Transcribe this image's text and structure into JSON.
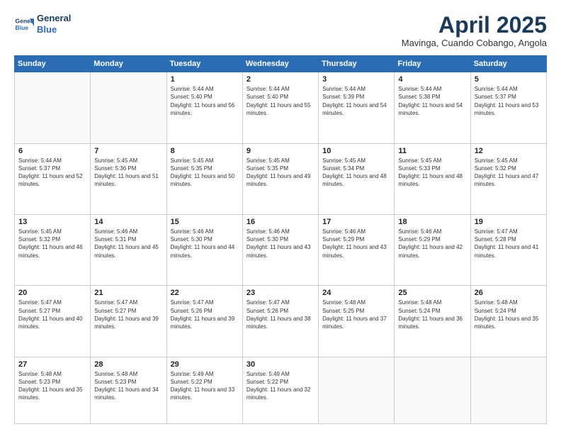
{
  "header": {
    "logo_line1": "General",
    "logo_line2": "Blue",
    "month": "April 2025",
    "location": "Mavinga, Cuando Cobango, Angola"
  },
  "weekdays": [
    "Sunday",
    "Monday",
    "Tuesday",
    "Wednesday",
    "Thursday",
    "Friday",
    "Saturday"
  ],
  "weeks": [
    [
      {
        "day": "",
        "info": ""
      },
      {
        "day": "",
        "info": ""
      },
      {
        "day": "1",
        "info": "Sunrise: 5:44 AM\nSunset: 5:40 PM\nDaylight: 11 hours and 56 minutes."
      },
      {
        "day": "2",
        "info": "Sunrise: 5:44 AM\nSunset: 5:40 PM\nDaylight: 11 hours and 55 minutes."
      },
      {
        "day": "3",
        "info": "Sunrise: 5:44 AM\nSunset: 5:39 PM\nDaylight: 11 hours and 54 minutes."
      },
      {
        "day": "4",
        "info": "Sunrise: 5:44 AM\nSunset: 5:38 PM\nDaylight: 11 hours and 54 minutes."
      },
      {
        "day": "5",
        "info": "Sunrise: 5:44 AM\nSunset: 5:37 PM\nDaylight: 11 hours and 53 minutes."
      }
    ],
    [
      {
        "day": "6",
        "info": "Sunrise: 5:44 AM\nSunset: 5:37 PM\nDaylight: 11 hours and 52 minutes."
      },
      {
        "day": "7",
        "info": "Sunrise: 5:45 AM\nSunset: 5:36 PM\nDaylight: 11 hours and 51 minutes."
      },
      {
        "day": "8",
        "info": "Sunrise: 5:45 AM\nSunset: 5:35 PM\nDaylight: 11 hours and 50 minutes."
      },
      {
        "day": "9",
        "info": "Sunrise: 5:45 AM\nSunset: 5:35 PM\nDaylight: 11 hours and 49 minutes."
      },
      {
        "day": "10",
        "info": "Sunrise: 5:45 AM\nSunset: 5:34 PM\nDaylight: 11 hours and 48 minutes."
      },
      {
        "day": "11",
        "info": "Sunrise: 5:45 AM\nSunset: 5:33 PM\nDaylight: 11 hours and 48 minutes."
      },
      {
        "day": "12",
        "info": "Sunrise: 5:45 AM\nSunset: 5:32 PM\nDaylight: 11 hours and 47 minutes."
      }
    ],
    [
      {
        "day": "13",
        "info": "Sunrise: 5:45 AM\nSunset: 5:32 PM\nDaylight: 11 hours and 46 minutes."
      },
      {
        "day": "14",
        "info": "Sunrise: 5:46 AM\nSunset: 5:31 PM\nDaylight: 11 hours and 45 minutes."
      },
      {
        "day": "15",
        "info": "Sunrise: 5:46 AM\nSunset: 5:30 PM\nDaylight: 11 hours and 44 minutes."
      },
      {
        "day": "16",
        "info": "Sunrise: 5:46 AM\nSunset: 5:30 PM\nDaylight: 11 hours and 43 minutes."
      },
      {
        "day": "17",
        "info": "Sunrise: 5:46 AM\nSunset: 5:29 PM\nDaylight: 11 hours and 43 minutes."
      },
      {
        "day": "18",
        "info": "Sunrise: 5:46 AM\nSunset: 5:29 PM\nDaylight: 11 hours and 42 minutes."
      },
      {
        "day": "19",
        "info": "Sunrise: 5:47 AM\nSunset: 5:28 PM\nDaylight: 11 hours and 41 minutes."
      }
    ],
    [
      {
        "day": "20",
        "info": "Sunrise: 5:47 AM\nSunset: 5:27 PM\nDaylight: 11 hours and 40 minutes."
      },
      {
        "day": "21",
        "info": "Sunrise: 5:47 AM\nSunset: 5:27 PM\nDaylight: 11 hours and 39 minutes."
      },
      {
        "day": "22",
        "info": "Sunrise: 5:47 AM\nSunset: 5:26 PM\nDaylight: 11 hours and 39 minutes."
      },
      {
        "day": "23",
        "info": "Sunrise: 5:47 AM\nSunset: 5:26 PM\nDaylight: 11 hours and 38 minutes."
      },
      {
        "day": "24",
        "info": "Sunrise: 5:48 AM\nSunset: 5:25 PM\nDaylight: 11 hours and 37 minutes."
      },
      {
        "day": "25",
        "info": "Sunrise: 5:48 AM\nSunset: 5:24 PM\nDaylight: 11 hours and 36 minutes."
      },
      {
        "day": "26",
        "info": "Sunrise: 5:48 AM\nSunset: 5:24 PM\nDaylight: 11 hours and 35 minutes."
      }
    ],
    [
      {
        "day": "27",
        "info": "Sunrise: 5:48 AM\nSunset: 5:23 PM\nDaylight: 11 hours and 35 minutes."
      },
      {
        "day": "28",
        "info": "Sunrise: 5:48 AM\nSunset: 5:23 PM\nDaylight: 11 hours and 34 minutes."
      },
      {
        "day": "29",
        "info": "Sunrise: 5:49 AM\nSunset: 5:22 PM\nDaylight: 11 hours and 33 minutes."
      },
      {
        "day": "30",
        "info": "Sunrise: 5:49 AM\nSunset: 5:22 PM\nDaylight: 11 hours and 32 minutes."
      },
      {
        "day": "",
        "info": ""
      },
      {
        "day": "",
        "info": ""
      },
      {
        "day": "",
        "info": ""
      }
    ]
  ]
}
